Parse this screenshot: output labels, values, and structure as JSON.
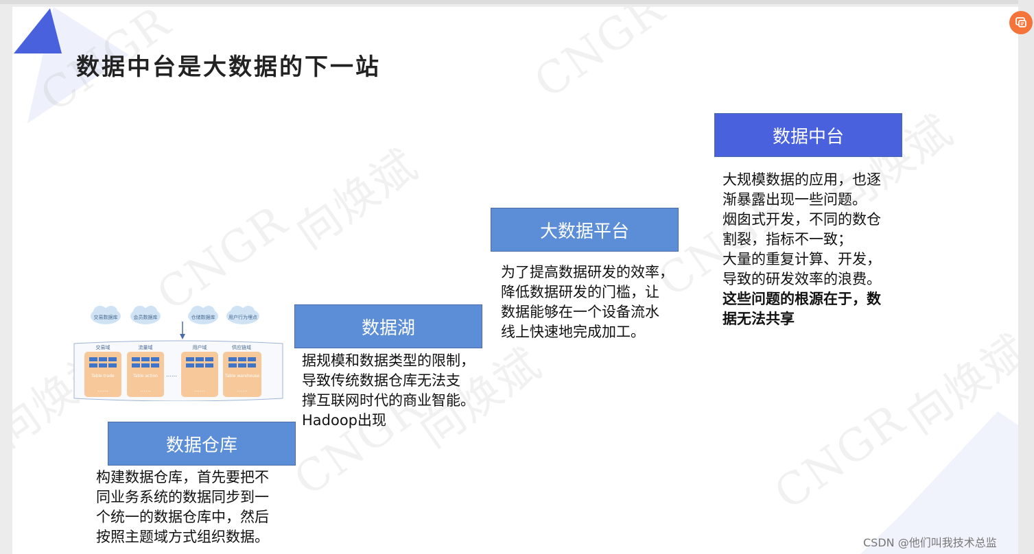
{
  "slide": {
    "title": "数据中台是大数据的下一站"
  },
  "watermarks": {
    "brand": "CNGR",
    "author": "向焕斌"
  },
  "stages": [
    {
      "id": "warehouse",
      "title": "数据仓库",
      "lines": [
        "构建数据仓库，首先要把不",
        "同业务系统的数据同步到一",
        "个统一的数据仓库中，然后",
        "按照主题域方式组织数据。"
      ]
    },
    {
      "id": "lake",
      "title": "数据湖",
      "lines": [
        "据规模和数据类型的限制，",
        "导致传统数据仓库无法支",
        "撑互联网时代的商业智能。",
        "Hadoop出现"
      ]
    },
    {
      "id": "platform",
      "title": "大数据平台",
      "lines": [
        "为了提高数据研发的效率，",
        "降低数据研发的门槛，让",
        "数据能够在一个设备流水",
        "线上快速地完成加工。"
      ]
    },
    {
      "id": "middle",
      "title": "数据中台",
      "lines": [
        "大规模数据的应用，也逐",
        "渐暴露出现一些问题。",
        "烟囱式开发，不同的数仓",
        "割裂，指标不一致；",
        "大量的重复计算、开发，",
        "导致的研发效率的浪费。"
      ],
      "bold_lines": [
        "这些问题的根源在于，数",
        "据无法共享"
      ]
    }
  ],
  "warehouse_diagram": {
    "clouds": [
      "交易数据库",
      "会员数据库",
      "仓储数据库",
      "用户行为埋点"
    ],
    "domains": [
      "交易域",
      "流量域",
      "用户域",
      "供应链域"
    ],
    "tables": [
      "Table trade",
      "Table action",
      "",
      "Table warehouse"
    ],
    "ellipsis": "……"
  },
  "footer": {
    "text": "CSDN @他们叫我技术总监"
  },
  "colors": {
    "header_blue": "#5b8ed6",
    "header_indigo": "#4a61dd",
    "accent_triangle": "#4a61dd",
    "feedback_orange": "#f5743a",
    "table_orange": "#f6c89a"
  },
  "icons": {
    "feedback": "feedback-icon"
  }
}
